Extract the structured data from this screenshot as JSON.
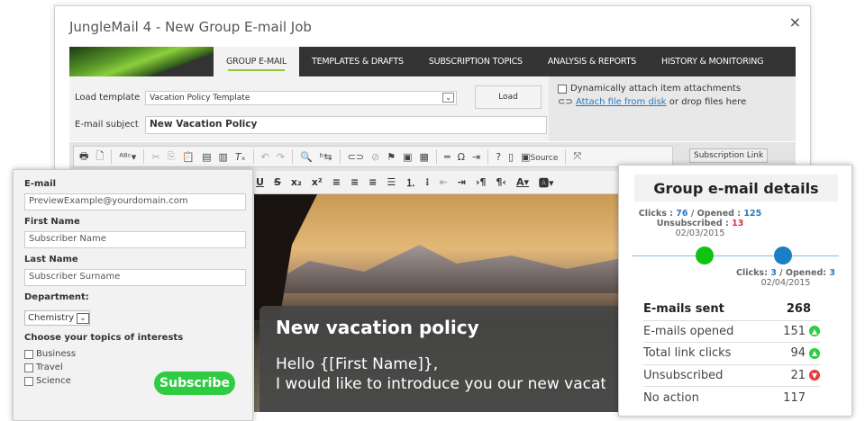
{
  "window": {
    "title": "JungleMail 4 - New Group E-mail Job",
    "close": "×"
  },
  "nav": {
    "tabs": [
      {
        "label": "GROUP E-MAIL"
      },
      {
        "label": "TEMPLATES & DRAFTS"
      },
      {
        "label": "SUBSCRIPTION TOPICS"
      },
      {
        "label": "ANALYSIS & REPORTS"
      },
      {
        "label": "HISTORY & MONITORING"
      }
    ]
  },
  "form": {
    "load_template_label": "Load template",
    "template_value": "Vacation Policy Template",
    "load_button": "Load",
    "subject_label": "E-mail subject",
    "subject_value": "New Vacation Policy",
    "dynamic_attach": "Dynamically attach item attachments",
    "attach_link": "Attach file from disk",
    "attach_rest": " or drop files here"
  },
  "toolbar": {
    "source": "Source",
    "subscription_link": "Subscription Link"
  },
  "subscribe_form": {
    "email_label": "E-mail",
    "email_value": "PreviewExample@yourdomain.com",
    "first_label": "First Name",
    "first_value": "Subscriber Name",
    "last_label": "Last Name",
    "last_value": "Subscriber Surname",
    "dept_label": "Department:",
    "dept_value": "Chemistry",
    "topics_label": "Choose your topics of interests",
    "topics": [
      "Business",
      "Travel",
      "Science"
    ],
    "subscribe_button": "Subscribe"
  },
  "email_body": {
    "heading": "New vacation policy",
    "line1": "Hello {[First Name]},",
    "line2": "I would like to introduce you our new vacation policy"
  },
  "details": {
    "title": "Group e-mail details",
    "point1": {
      "clicks_label": "Clicks : ",
      "clicks": "76",
      "opened_label": " / Opened : ",
      "opened": "125",
      "unsub_label": "Unsubscribed : ",
      "unsub": "13",
      "date": "02/03/2015"
    },
    "point2": {
      "clicks_label": "Clicks: ",
      "clicks": "3",
      "opened_label": " / Opened: ",
      "opened": "3",
      "date": "02/04/2015"
    },
    "stats": [
      {
        "label": "E-mails sent",
        "value": "268"
      },
      {
        "label": "E-mails opened",
        "value": "151",
        "trend": "up"
      },
      {
        "label": "Total link clicks",
        "value": "94",
        "trend": "up"
      },
      {
        "label": "Unsubscribed",
        "value": "21",
        "trend": "down"
      },
      {
        "label": "No action",
        "value": "117"
      }
    ],
    "colors": {
      "up": "#2ecc40",
      "down": "#e83a3a",
      "point1": "#11c411",
      "point2": "#1a7fc4"
    }
  }
}
